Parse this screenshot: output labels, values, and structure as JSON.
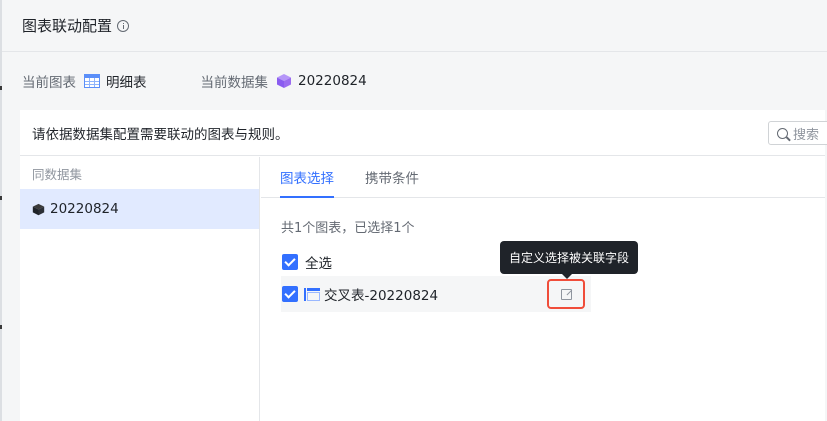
{
  "dialog": {
    "title": "图表联动配置"
  },
  "meta": {
    "current_chart_label": "当前图表",
    "current_chart_value": "明细表",
    "current_dataset_label": "当前数据集",
    "current_dataset_value": "20220824"
  },
  "panel": {
    "instruction": "请依据数据集配置需要联动的图表与规则。",
    "search_placeholder": "搜索"
  },
  "sidebar": {
    "group_title": "同数据集",
    "items": [
      {
        "label": "20220824",
        "selected": true
      }
    ]
  },
  "tabs": [
    {
      "label": "图表选择",
      "active": true
    },
    {
      "label": "携带条件",
      "active": false
    }
  ],
  "chart_selection": {
    "count_text": "共1个图表，已选择1个",
    "select_all_label": "全选",
    "select_all_checked": true,
    "charts": [
      {
        "label": "交叉表-20220824",
        "checked": true
      }
    ]
  },
  "tooltip": {
    "text": "自定义选择被关联字段"
  },
  "colors": {
    "accent": "#3370ff",
    "highlight_border": "#f04d3a",
    "selected_bg": "#e1eaff",
    "dataset_icon": "#9b6cf0"
  },
  "icons": {
    "title_info": "info-circle-icon",
    "current_chart": "table-icon",
    "current_dataset": "cube-icon",
    "search": "search-icon",
    "sidebar_dataset": "cube-icon",
    "chart_item": "cross-table-icon",
    "edit": "edit-icon"
  }
}
